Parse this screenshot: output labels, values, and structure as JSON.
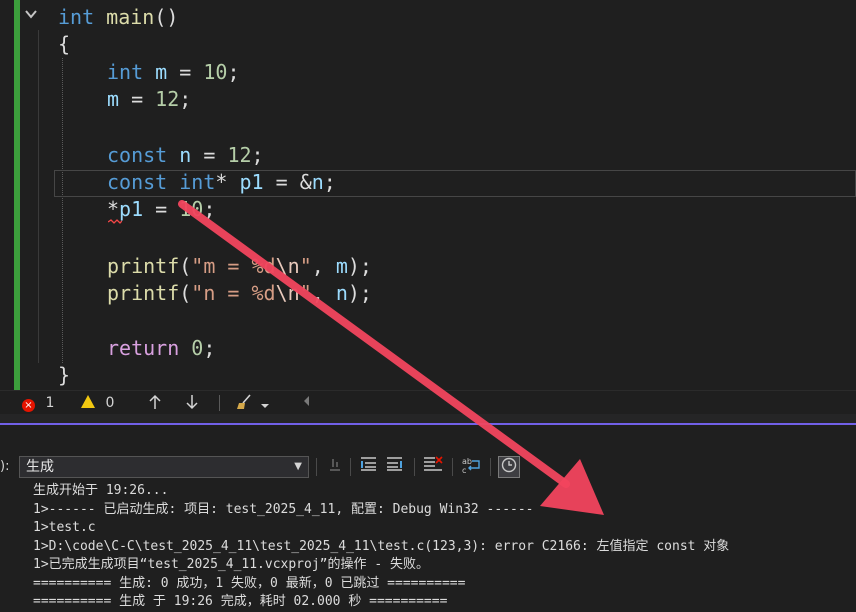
{
  "editor": {
    "signature": [
      "int",
      " ",
      "main",
      "()"
    ],
    "lines": {
      "open_brace": "{",
      "decl_m": [
        "int",
        " ",
        "m",
        " = ",
        "10",
        ";"
      ],
      "assign_m": [
        "m",
        " = ",
        "12",
        ";"
      ],
      "decl_n": [
        "const",
        " ",
        "n",
        " = ",
        "12",
        ";"
      ],
      "decl_p1": [
        "const",
        " ",
        "int",
        "* ",
        "p1",
        " = &",
        "n",
        ";"
      ],
      "assign_p1": [
        "*",
        "p1",
        " = ",
        "10",
        ";"
      ],
      "printf_m": [
        "printf",
        "(",
        "\"m = ",
        "%d",
        "\\n",
        "\"",
        ", ",
        "m",
        ");"
      ],
      "printf_n": [
        "printf",
        "(",
        "\"n = ",
        "%d",
        "\\n",
        "\"",
        ", ",
        "n",
        ");"
      ],
      "ret": [
        "return",
        " ",
        "0",
        ";"
      ],
      "close_brace": "}"
    },
    "fold_icon": "chevron-down-icon",
    "gutter_color": "#3c9e3c"
  },
  "statusbar": {
    "errors": "1",
    "warnings": "0",
    "error_icon": "×"
  },
  "output_panel": {
    "show_from_label": "):",
    "source": "生成",
    "lines": [
      "生成开始于 19:26...",
      "1>------ 已启动生成: 项目: test_2025_4_11, 配置: Debug Win32 ------",
      "1>test.c",
      "1>D:\\code\\C-C\\test_2025_4_11\\test_2025_4_11\\test.c(123,3): error C2166: 左值指定 const 对象",
      "1>已完成生成项目“test_2025_4_11.vcxproj”的操作 - 失败。",
      "========== 生成: 0 成功，1 失败，0 最新，0 已跳过 ==========",
      "========== 生成 于 19:26 完成，耗时 02.000 秒 =========="
    ]
  },
  "colors": {
    "accent": "#7160e8",
    "annotation_arrow": "#f2455e",
    "error": "#e51400",
    "warning": "#f2c811"
  }
}
